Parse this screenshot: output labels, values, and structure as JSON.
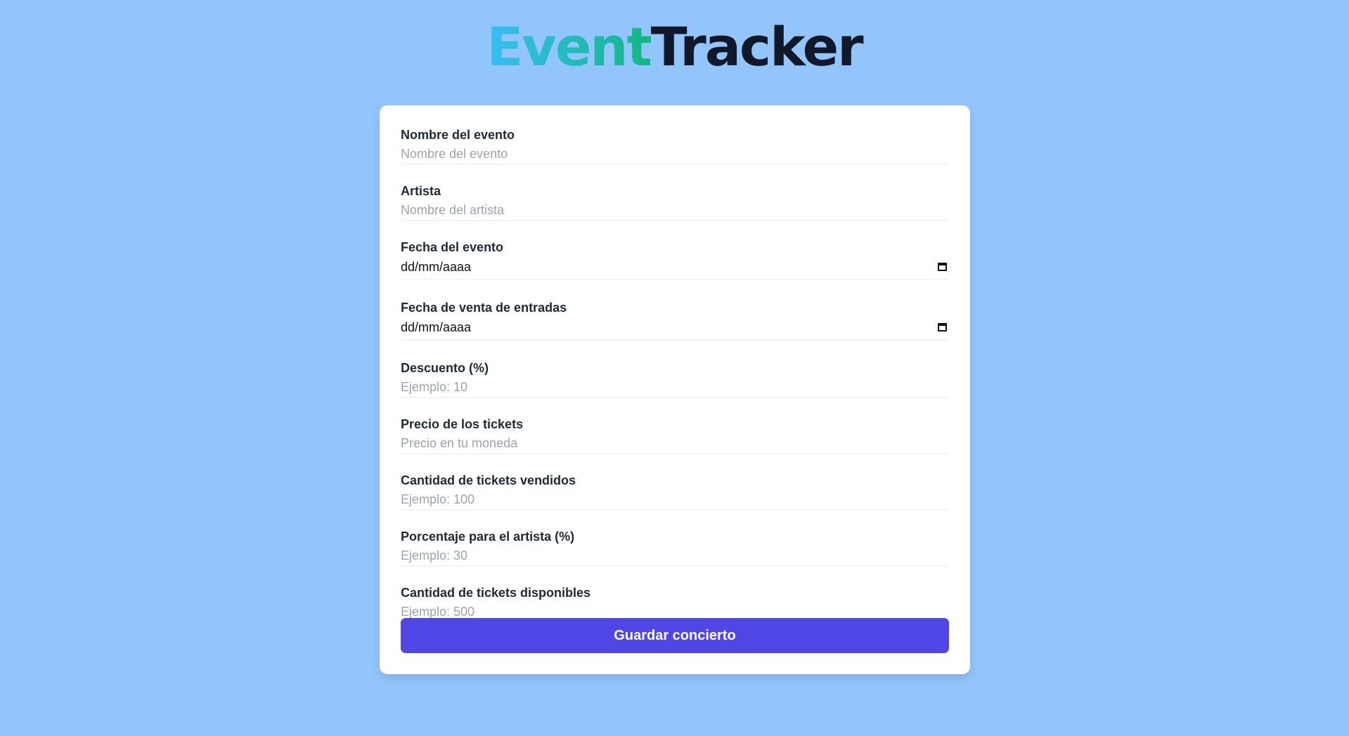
{
  "brand": {
    "part1": "Event",
    "part2": "Tracker"
  },
  "form": {
    "fields": [
      {
        "label": "Nombre del evento",
        "placeholder": "Nombre del evento",
        "type": "text"
      },
      {
        "label": "Artista",
        "placeholder": "Nombre del artista",
        "type": "text"
      },
      {
        "label": "Fecha del evento",
        "placeholder": "dd/mm/aaaa",
        "type": "date"
      },
      {
        "label": "Fecha de venta de entradas",
        "placeholder": "dd/mm/aaaa",
        "type": "date"
      },
      {
        "label": "Descuento (%)",
        "placeholder": "Ejemplo: 10",
        "type": "number"
      },
      {
        "label": "Precio de los tickets",
        "placeholder": "Precio en tu moneda",
        "type": "number"
      },
      {
        "label": "Cantidad de tickets vendidos",
        "placeholder": "Ejemplo: 100",
        "type": "number"
      },
      {
        "label": "Porcentaje para el artista (%)",
        "placeholder": "Ejemplo: 30",
        "type": "number"
      },
      {
        "label": "Cantidad de tickets disponibles",
        "placeholder": "Ejemplo: 500",
        "type": "number"
      }
    ],
    "submit_label": "Guardar concierto"
  },
  "colors": {
    "page_background": "#93c5fd",
    "button": "#4f46e5",
    "brand_gradient_start": "#38bdf8",
    "brand_gradient_end": "#10b981",
    "brand_dark": "#111827"
  },
  "icons": {
    "date_field": "calendar-icon"
  }
}
